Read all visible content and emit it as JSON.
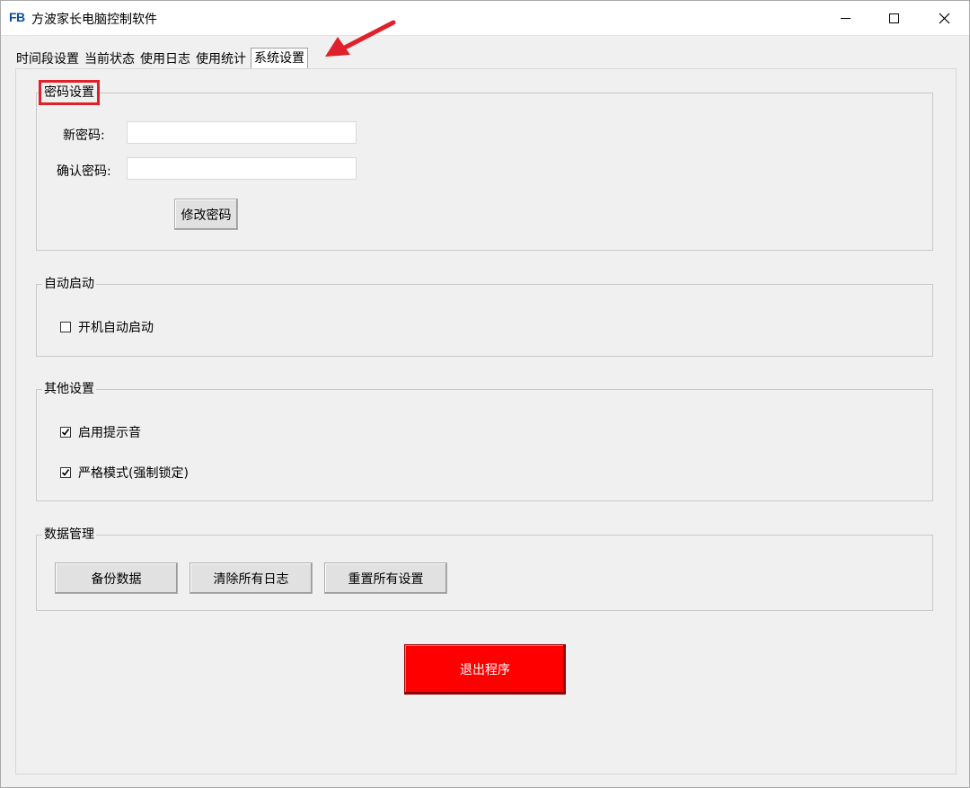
{
  "window": {
    "logo": "FB",
    "title": "方波家长电脑控制软件",
    "controls": {
      "minimize": "minimize-icon",
      "maximize": "maximize-icon",
      "close": "close-icon"
    }
  },
  "tabs": [
    {
      "label": "时间段设置",
      "active": false
    },
    {
      "label": "当前状态",
      "active": false
    },
    {
      "label": "使用日志",
      "active": false
    },
    {
      "label": "使用统计",
      "active": false
    },
    {
      "label": "系统设置",
      "active": true
    }
  ],
  "password_group": {
    "title": "密码设置",
    "new_password_label": "新密码:",
    "new_password_value": "",
    "confirm_password_label": "确认密码:",
    "confirm_password_value": "",
    "change_button": "修改密码"
  },
  "autostart_group": {
    "title": "自动启动",
    "checkbox_label": "开机自动启动",
    "checked": false
  },
  "other_group": {
    "title": "其他设置",
    "sound_label": "启用提示音",
    "sound_checked": true,
    "strict_label": "严格模式(强制锁定)",
    "strict_checked": true
  },
  "data_group": {
    "title": "数据管理",
    "backup_button": "备份数据",
    "clear_logs_button": "清除所有日志",
    "reset_button": "重置所有设置"
  },
  "exit_button": "退出程序",
  "colors": {
    "exit_bg": "#ff0000",
    "annotation": "#e0202a",
    "logo": "#0a4fa3"
  }
}
